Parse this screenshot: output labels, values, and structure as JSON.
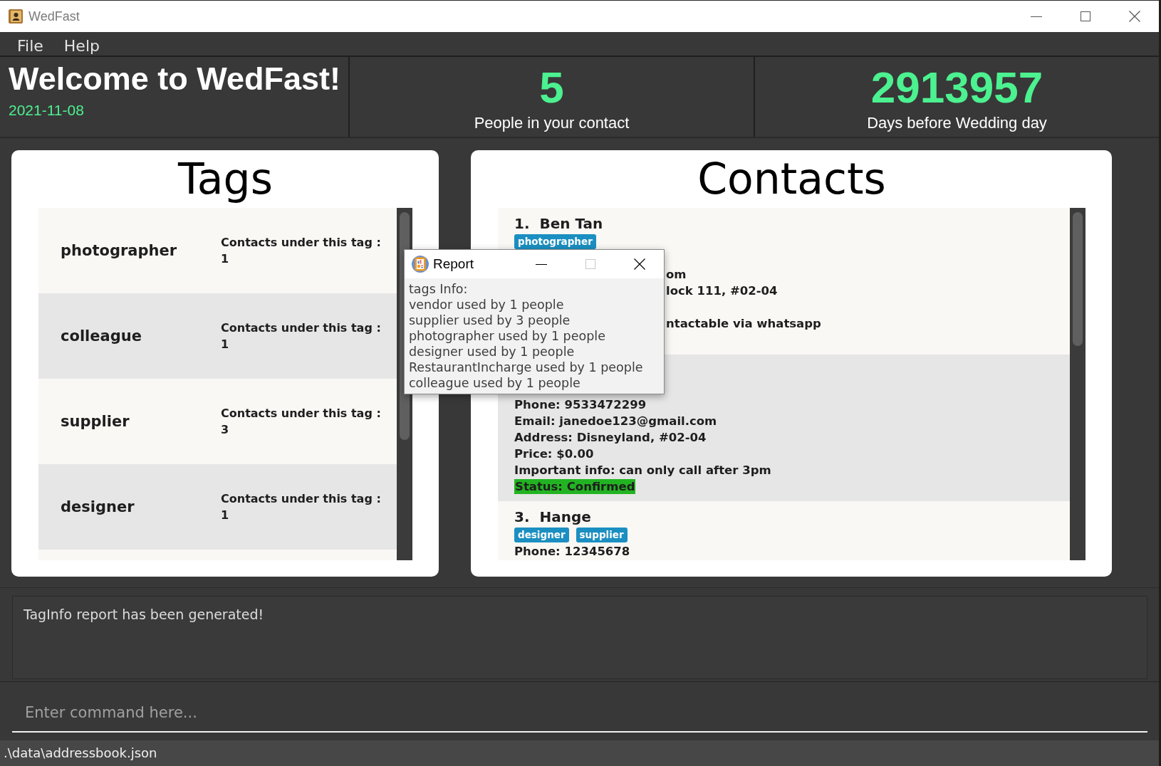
{
  "window": {
    "title": "WedFast",
    "controls": [
      {
        "kind": "minimize",
        "disabled": false
      },
      {
        "kind": "maximize",
        "disabled": false
      },
      {
        "kind": "close",
        "disabled": false
      }
    ]
  },
  "menu": [
    "File",
    "Help"
  ],
  "header": {
    "welcome": "Welcome to WedFast!",
    "date": "2021-11-08",
    "stats": [
      {
        "value": "5",
        "label": "People in your contact"
      },
      {
        "value": "2913957",
        "label": "Days before Wedding day"
      }
    ]
  },
  "tags_panel": {
    "title": "Tags",
    "items": [
      {
        "name": "photographer",
        "caption": "Contacts under this tag :",
        "count": "1"
      },
      {
        "name": "colleague",
        "caption": "Contacts under this tag :",
        "count": "1"
      },
      {
        "name": "supplier",
        "caption": "Contacts under this tag :",
        "count": "3"
      },
      {
        "name": "designer",
        "caption": "Contacts under this tag :",
        "count": "1"
      }
    ]
  },
  "contacts_panel": {
    "title": "Contacts",
    "contacts": [
      {
        "index": "1.",
        "name": "Ben Tan",
        "tags": [
          "photographer"
        ],
        "covered_by_report": true,
        "fields": [
          {
            "kind": "email",
            "text": "om"
          },
          {
            "kind": "address",
            "text": "lock 111, #02-04"
          },
          {
            "kind": "info",
            "text": "ntactable via whatsapp"
          }
        ]
      },
      {
        "covered_by_report": false,
        "fields": [
          {
            "kind": "phone",
            "text": "Phone: 9533472299"
          },
          {
            "kind": "email",
            "text": "Email: janedoe123@gmail.com"
          },
          {
            "kind": "address",
            "text": "Address: Disneyland, #02-04"
          },
          {
            "kind": "price",
            "text": "Price: $0.00"
          },
          {
            "kind": "info",
            "text": "Important info: can only call after 3pm"
          }
        ],
        "status": {
          "text": "Status: Confirmed",
          "color": "#22b322"
        }
      },
      {
        "index": "3.",
        "name": "Hange",
        "tags": [
          "designer",
          "supplier"
        ],
        "covered_by_report": false,
        "fields": [
          {
            "kind": "phone",
            "text": "Phone: 12345678"
          }
        ]
      }
    ]
  },
  "result_display": "TagInfo report has been generated!",
  "command_box": {
    "placeholder": "Enter command here..."
  },
  "status_bar": ".\\data\\addressbook.json",
  "report_window": {
    "title": "Report",
    "controls": [
      {
        "kind": "minimize",
        "disabled": false
      },
      {
        "kind": "maximize",
        "disabled": true
      },
      {
        "kind": "close",
        "disabled": false
      }
    ],
    "lines": [
      "tags Info:",
      "vendor used by 1 people",
      "supplier used by 3 people",
      "photographer used by 1 people",
      "designer used by 1 people",
      "RestaurantIncharge used by 1 people",
      "colleague used by 1 people"
    ]
  }
}
